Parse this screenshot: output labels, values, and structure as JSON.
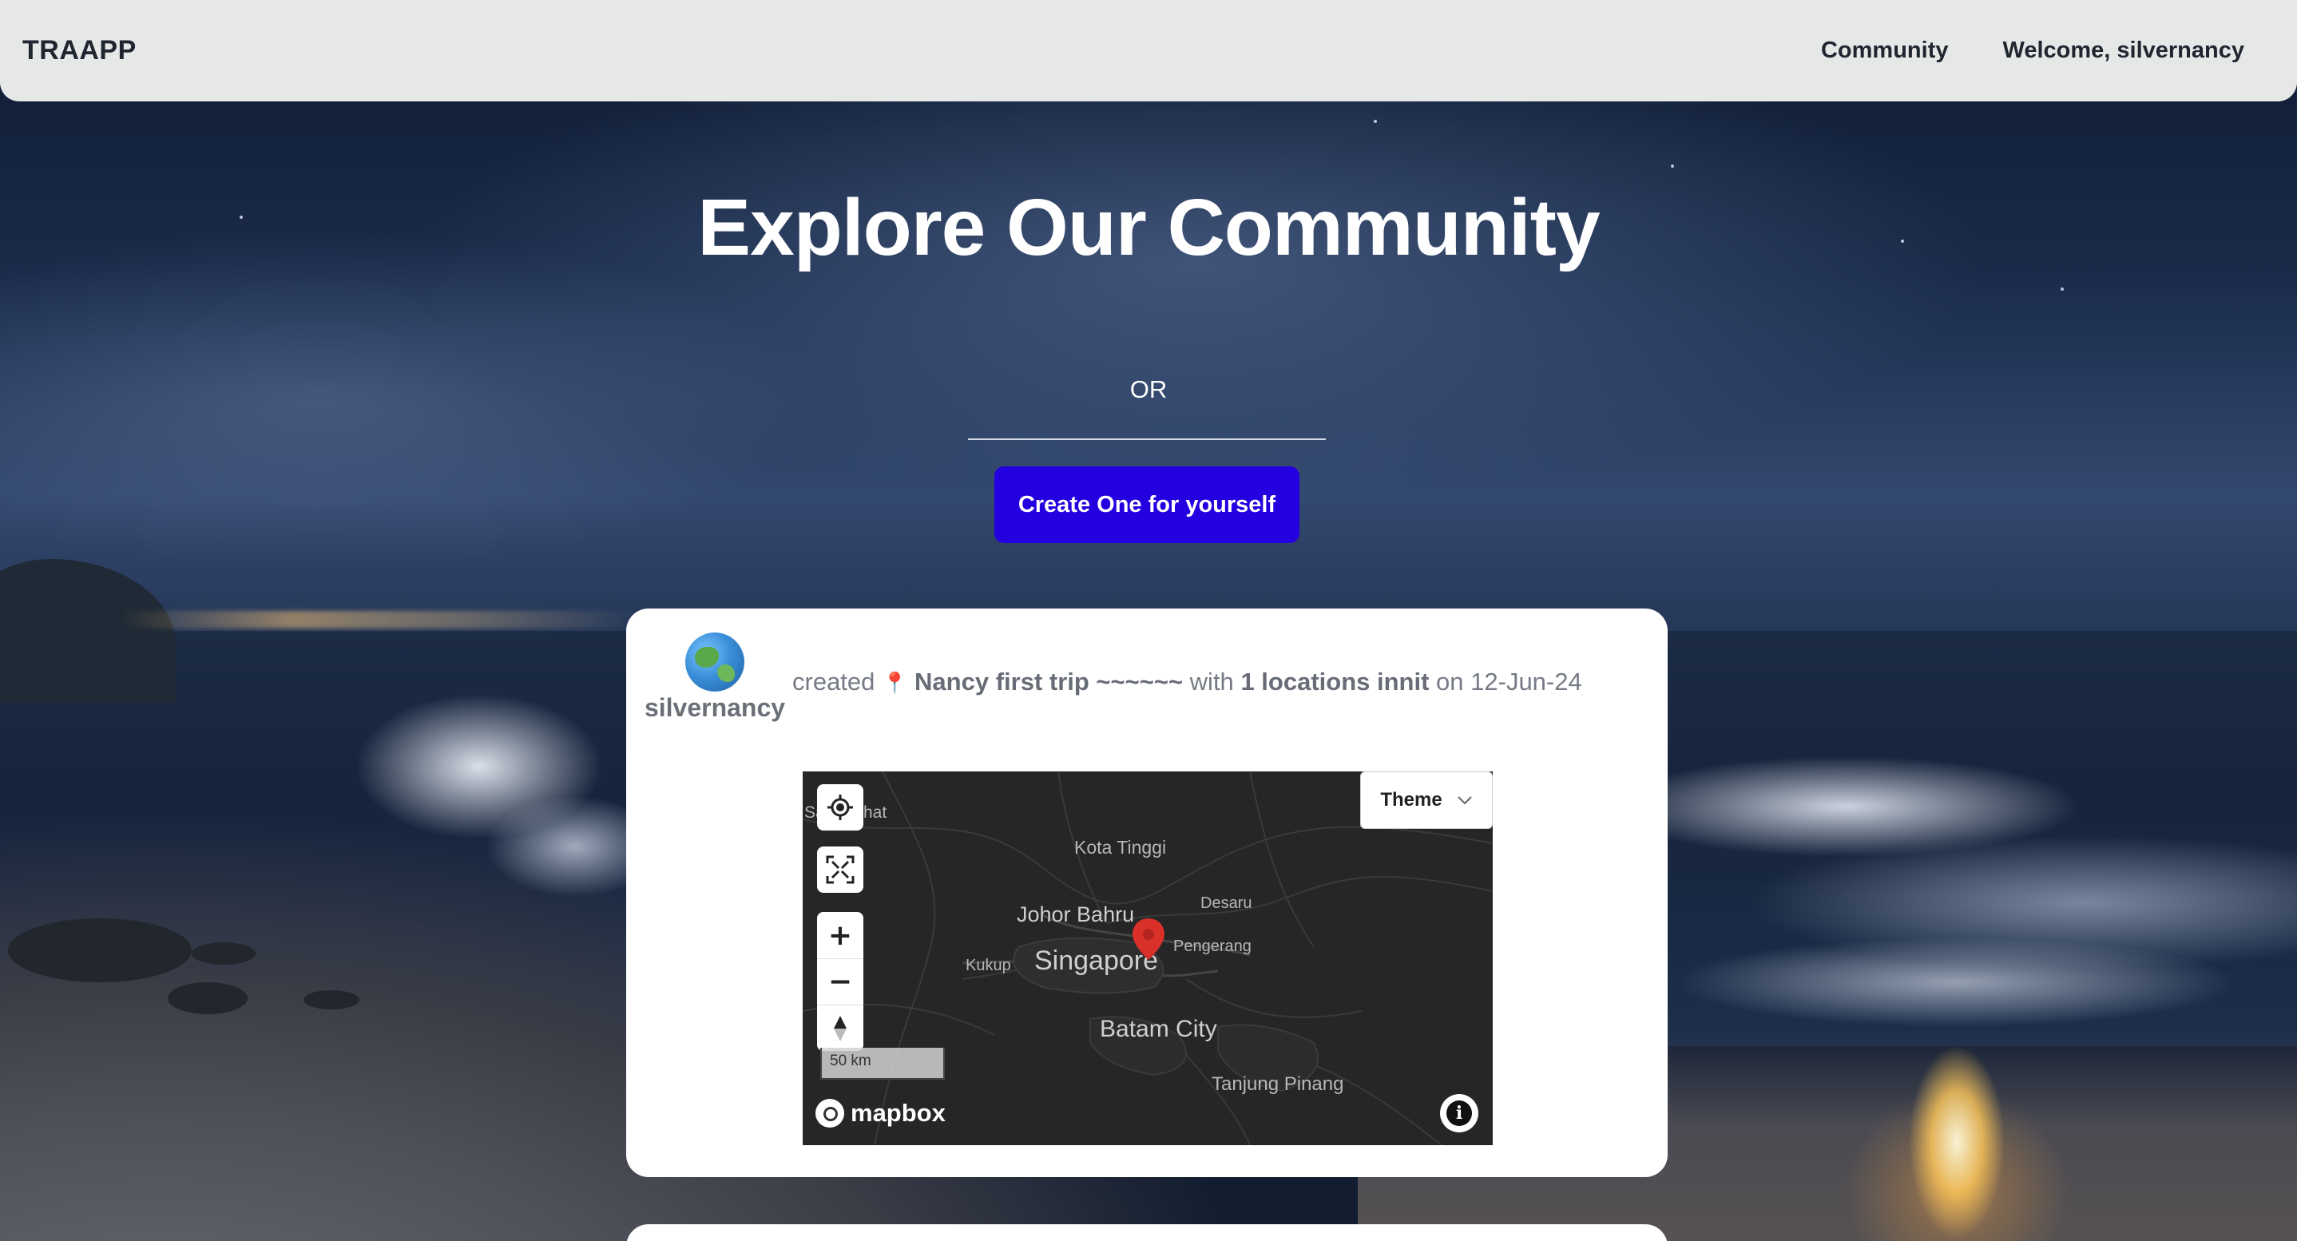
{
  "nav": {
    "brand": "TRAAPP",
    "links": [
      {
        "label": "Community"
      },
      {
        "label": "Welcome, silvernancy"
      }
    ]
  },
  "hero": {
    "title": "Explore Our Community",
    "or_text": "OR",
    "create_button": "Create One for yourself"
  },
  "posts": [
    {
      "author": "silvernancy",
      "avatar_icon": "globe-emoji",
      "prefix": "created",
      "pin_icon": "📍",
      "trip_name": "Nancy first trip ~~~~~~",
      "with_text": "with",
      "locations_text": "1 locations innit",
      "on_text": "on",
      "date": "12-Jun-24",
      "map": {
        "theme_label": "Theme",
        "scale_label": "50 km",
        "attribution_logo": "mapbox",
        "labels": {
          "kota_tinggi": "Kota Tinggi",
          "johor_bahru": "Johor Bahru",
          "desaru": "Desaru",
          "kukup": "Kukup",
          "singapore": "Singapore",
          "pengerang": "Pengerang",
          "batam_city": "Batam City",
          "tanjung_pinang": "Tanjung Pinang",
          "edge_left": "Sa",
          "edge_hat": "hat"
        },
        "zoom_in": "+",
        "zoom_out": "−",
        "marker_color": "#d9302a"
      }
    }
  ],
  "colors": {
    "accent": "#2400e0",
    "nav_bg": "#e6e8e8"
  }
}
